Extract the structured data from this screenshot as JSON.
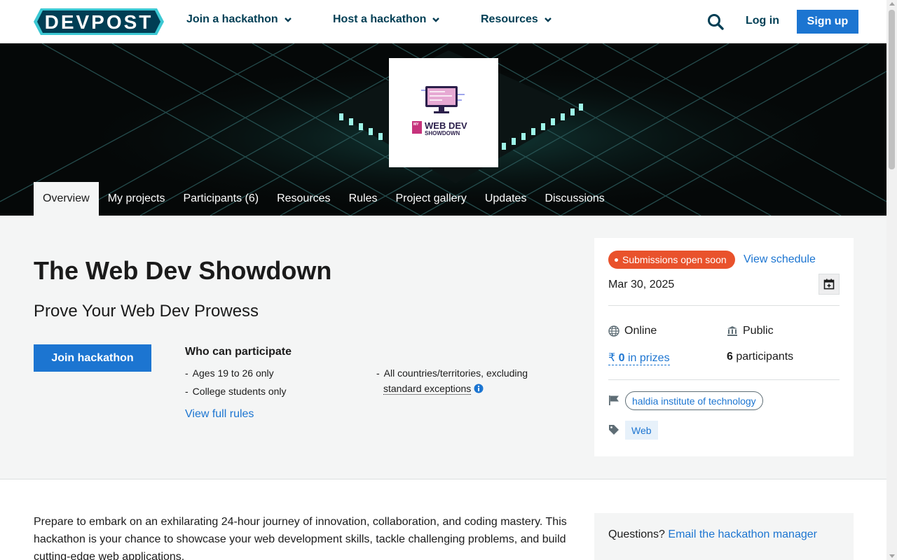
{
  "header": {
    "logo_text": "DEVPOST",
    "nav": [
      {
        "label": "Join a hackathon",
        "icon": "chevron-down-icon"
      },
      {
        "label": "Host a hackathon",
        "icon": "chevron-down-icon"
      },
      {
        "label": "Resources",
        "icon": "chevron-down-icon"
      }
    ],
    "search_icon": "search-icon",
    "login_label": "Log in",
    "signup_label": "Sign up"
  },
  "banner": {
    "event_logo_text_line1": "WEB DEV",
    "event_logo_text_line2": "SHOWDOWN",
    "event_logo_badge": "MY"
  },
  "tabs": [
    {
      "label": "Overview",
      "active": true
    },
    {
      "label": "My projects"
    },
    {
      "label": "Participants (6)"
    },
    {
      "label": "Resources"
    },
    {
      "label": "Rules"
    },
    {
      "label": "Project gallery"
    },
    {
      "label": "Updates"
    },
    {
      "label": "Discussions"
    }
  ],
  "challenge": {
    "title": "The Web Dev Showdown",
    "tagline": "Prove Your Web Dev Prowess",
    "join_label": "Join hackathon",
    "who_title": "Who can participate",
    "eligibility": [
      "Ages 19 to 26 only",
      "College students only",
      "All countries/territories, excluding"
    ],
    "standard_exceptions": "standard exceptions",
    "rules_link": "View full rules"
  },
  "card": {
    "status": "Submissions open soon",
    "schedule_link": "View schedule",
    "date": "Mar 30, 2025",
    "location": "Online",
    "visibility": "Public",
    "prizes_currency": "₹",
    "prizes_amount": "0",
    "prizes_label": "in prizes",
    "participants_count": "6",
    "participants_label": "participants",
    "host": "haldia institute of technology",
    "theme": "Web"
  },
  "description": {
    "text": "Prepare to embark on an exhilarating 24-hour journey of innovation, collaboration, and coding mastery. This hackathon is your chance to showcase your web development skills, tackle challenging problems, and build cutting-edge web applications."
  },
  "questions": {
    "prefix": "Questions?",
    "link": "Email the hackathon manager"
  },
  "colors": {
    "brand_dark": "#003e54",
    "primary_blue": "#1c75d1",
    "status_orange": "#e9522c",
    "section_bg": "#f4f5f5"
  }
}
